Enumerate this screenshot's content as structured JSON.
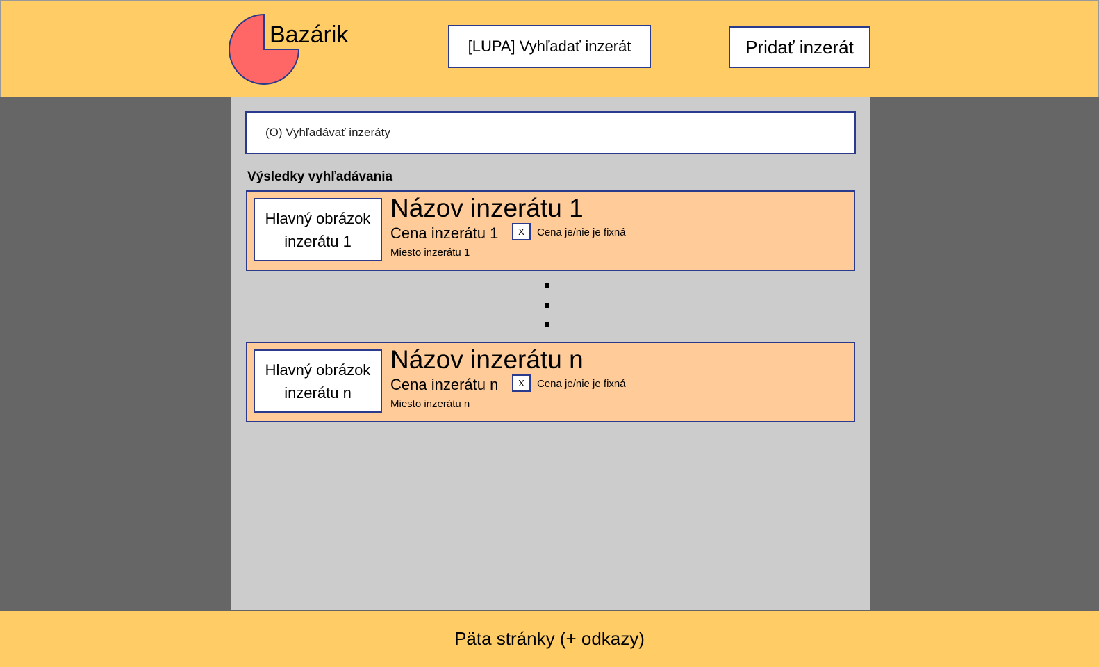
{
  "header": {
    "brand": "Bazárik",
    "search_button": "[LUPA] Vyhľadať inzerát",
    "add_button": "Pridať inzerát"
  },
  "search": {
    "placeholder": "(O) Vyhľadávať inzeráty"
  },
  "results": {
    "title": "Výsledky vyhľadávania",
    "items": [
      {
        "image": "Hlavný obrázok inzerátu 1",
        "title": "Názov inzerátu 1",
        "price": "Cena inzerátu 1",
        "checkbox": "X",
        "fixed_label": "Cena je/nie je fixná",
        "place": "Miesto inzerátu 1"
      },
      {
        "image": "Hlavný obrázok inzerátu n",
        "title": "Názov inzerátu n",
        "price": "Cena inzerátu n",
        "checkbox": "X",
        "fixed_label": "Cena je/nie je fixná",
        "place": "Miesto inzerátu n"
      }
    ]
  },
  "footer": {
    "text": "Päta stránky (+ odkazy)"
  },
  "colors": {
    "header": "#FFCC66",
    "card": "#FFCC99",
    "border": "#2A3A8C",
    "logo": "#FF6666"
  }
}
